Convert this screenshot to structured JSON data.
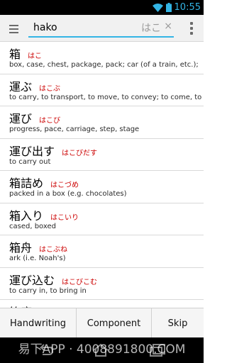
{
  "status_bar": {
    "time": "10:55",
    "icons": [
      "wifi-icon",
      "battery-icon"
    ],
    "accent_color": "#33b5e5"
  },
  "action_bar": {
    "menu_icon": "menu-icon",
    "search_value": "hako",
    "kana_preview": "はこ",
    "clear_glyph": "×",
    "overflow_icon": "overflow-icon",
    "accent_color": "#33b5e5"
  },
  "results": [
    {
      "kanji": "箱",
      "reading": "はこ",
      "gloss": "box, case, chest, package, pack; car (of a train, etc.);"
    },
    {
      "kanji": "運ぶ",
      "reading": "はこぶ",
      "gloss": "to carry, to transport, to move, to convey; to come, to"
    },
    {
      "kanji": "運び",
      "reading": "はこび",
      "gloss": "progress, pace, carriage, step, stage"
    },
    {
      "kanji": "運び出す",
      "reading": "はこびだす",
      "gloss": "to carry out"
    },
    {
      "kanji": "箱詰め",
      "reading": "はこづめ",
      "gloss": "packed in a box (e.g. chocolates)"
    },
    {
      "kanji": "箱入り",
      "reading": "はこいり",
      "gloss": "cased, boxed"
    },
    {
      "kanji": "箱舟",
      "reading": "はこぶね",
      "gloss": "ark (i.e. Noah's)"
    },
    {
      "kanji": "運び込む",
      "reading": "はこびこむ",
      "gloss": "to carry in, to bring in"
    },
    {
      "kanji": "箱庭",
      "reading": "",
      "gloss": ""
    }
  ],
  "reading_color": "#cc0000",
  "bottom_buttons": [
    "Handwriting",
    "Component",
    "Skip"
  ],
  "nav_bar": {
    "icons": [
      "back-icon",
      "home-icon",
      "recents-icon"
    ],
    "watermark": "易下APP · 4008891800.COM"
  }
}
